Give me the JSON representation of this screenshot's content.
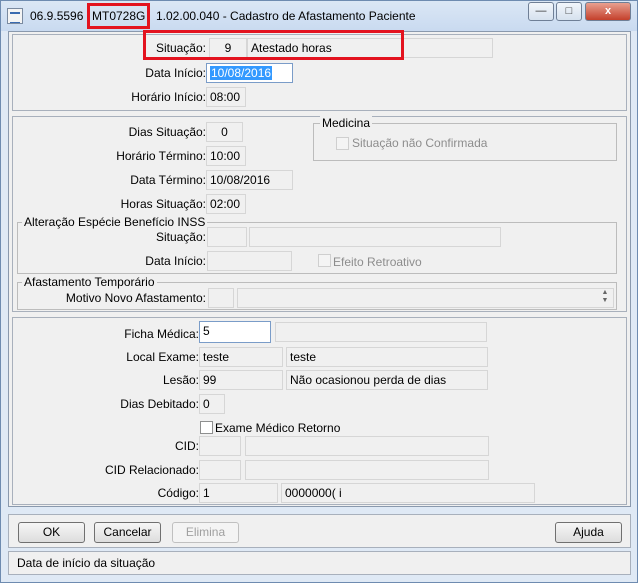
{
  "titlebar": {
    "version": "06.9.5596",
    "program": "MT0728G",
    "title": "1.02.00.040 - Cadastro de Afastamento Paciente",
    "minimize": "—",
    "maximize": "□",
    "close": "x"
  },
  "section1": {
    "situacao_label": "Situação:",
    "situacao_code": "9",
    "situacao_desc": "Atestado horas",
    "data_inicio_label": "Data Início:",
    "data_inicio_value": "10/08/2016",
    "horario_inicio_label": "Horário Início:",
    "horario_inicio_value": "08:00"
  },
  "section2": {
    "dias_situacao_label": "Dias Situação:",
    "dias_situacao_value": "0",
    "horario_termino_label": "Horário Término:",
    "horario_termino_value": "10:00",
    "data_termino_label": "Data Término:",
    "data_termino_value": "10/08/2016",
    "horas_situacao_label": "Horas Situação:",
    "horas_situacao_value": "02:00",
    "medicina_title": "Medicina",
    "situacao_nao_confirmada": "Situação não Confirmada",
    "alteracao_title": "Alteração Espécie Benefício INSS",
    "alt_situacao_label": "Situação:",
    "alt_data_inicio_label": "Data Início:",
    "efeito_retroativo": "Efeito Retroativo",
    "afastamento_title": "Afastamento Temporário",
    "motivo_label": "Motivo Novo Afastamento:"
  },
  "section3": {
    "ficha_label": "Ficha Médica:",
    "ficha_value": "5",
    "local_label": "Local Exame:",
    "local_code": "teste",
    "local_desc": "teste",
    "lesao_label": "Lesão:",
    "lesao_code": "99",
    "lesao_desc": "Não ocasionou perda de dias",
    "dias_debitado_label": "Dias Debitado:",
    "dias_debitado_value": "0",
    "exame_retorno": "Exame Médico Retorno",
    "cid_label": "CID:",
    "cid_relacionado_label": "CID Relacionado:",
    "codigo_label": "Código:",
    "codigo_value": "1",
    "codigo_desc": "0000000( i"
  },
  "buttons": {
    "ok": "OK",
    "cancelar": "Cancelar",
    "elimina": "Elimina",
    "ajuda": "Ajuda"
  },
  "status": {
    "text": "Data de início da situação"
  }
}
